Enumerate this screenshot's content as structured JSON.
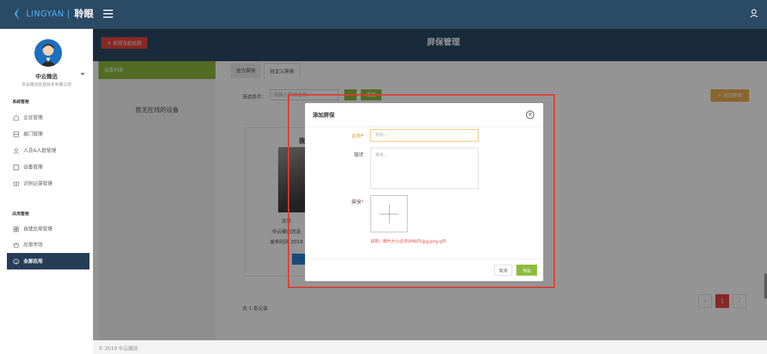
{
  "app": {
    "logo_text": "LINGYAN |",
    "logo_cn": "聆眼"
  },
  "sidebar": {
    "user_name": "中云微迅",
    "company": "中云微迅信息技术有限公司",
    "sections": [
      {
        "title": "系统管理",
        "items": [
          {
            "label": "企业管理",
            "icon": "home-icon"
          },
          {
            "label": "部门管理",
            "icon": "department-icon"
          },
          {
            "label": "人员&人脸管理",
            "icon": "person-icon"
          },
          {
            "label": "设备管理",
            "icon": "device-icon"
          },
          {
            "label": "识别记录管理",
            "icon": "record-icon"
          }
        ]
      },
      {
        "title": "应用管理",
        "items": [
          {
            "label": "自建应用管理",
            "icon": "grid-icon"
          },
          {
            "label": "应用市场",
            "icon": "shop-icon"
          },
          {
            "label": "全部应用",
            "icon": "cube-icon",
            "active": true
          }
        ]
      }
    ]
  },
  "header": {
    "close_app_label": "关闭当前应用",
    "page_title": "屏保管理"
  },
  "left_panel": {
    "title": "设备列表",
    "empty": "暂无在线的设备"
  },
  "tabs": [
    {
      "label": "官方屏保"
    },
    {
      "label": "自定义屏保",
      "active": true
    }
  ],
  "filter": {
    "label": "筛选条件：",
    "placeholder": "请输入屏保名称",
    "reset_label": "重置",
    "add_label": "+ 添加屏保"
  },
  "card": {
    "title": "我",
    "line1": "共享",
    "line2": "中云微迅信息",
    "line3": "发布时间 2019"
  },
  "list": {
    "total": "共 1 条记录",
    "page_current": "1",
    "prev": "‹",
    "next": "›"
  },
  "footer": {
    "text": "© 2019 中云微迅"
  },
  "modal": {
    "title": "添加屏保",
    "name_label": "名称",
    "name_placeholder": "名称...",
    "desc_label": "描述",
    "desc_placeholder": "描述...",
    "screensaver_label": "屏保",
    "required_mark": "*",
    "note": "说明：图片大小必须3MB内(jpg,png,gif)",
    "cancel_label": "取消",
    "add_label": "添加"
  },
  "colors": {
    "header_bg": "#2b4a66",
    "accent_green": "#8dbb3e",
    "danger_red": "#e9463e",
    "sidebar_active": "#263d58"
  }
}
